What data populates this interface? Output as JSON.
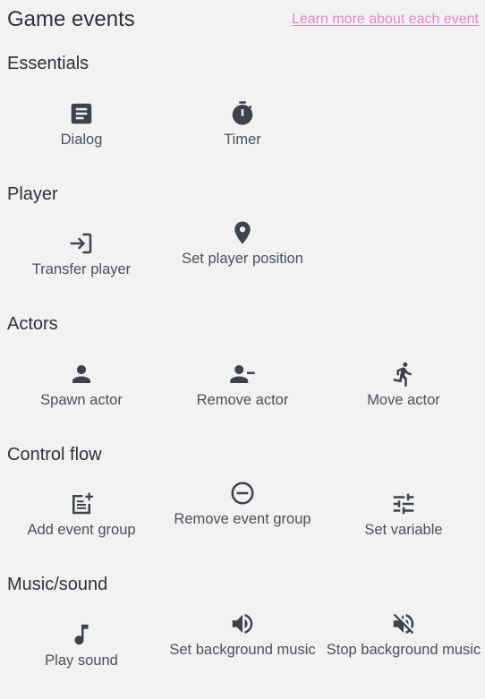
{
  "header": {
    "title": "Game events",
    "learn_link": "Learn more about each event"
  },
  "sections": [
    {
      "title": "Essentials",
      "events": [
        {
          "label": "Dialog",
          "icon": "dialog-icon"
        },
        {
          "label": "Timer",
          "icon": "timer-icon"
        }
      ]
    },
    {
      "title": "Player",
      "events": [
        {
          "label": "Transfer player",
          "icon": "transfer-icon"
        },
        {
          "label": "Set player position",
          "icon": "location-pin-icon"
        }
      ]
    },
    {
      "title": "Actors",
      "events": [
        {
          "label": "Spawn actor",
          "icon": "person-icon"
        },
        {
          "label": "Remove actor",
          "icon": "person-remove-icon"
        },
        {
          "label": "Move actor",
          "icon": "running-person-icon"
        }
      ]
    },
    {
      "title": "Control flow",
      "events": [
        {
          "label": "Add event group",
          "icon": "note-add-icon"
        },
        {
          "label": "Remove event group",
          "icon": "minus-circle-icon"
        },
        {
          "label": "Set variable",
          "icon": "sliders-icon"
        }
      ]
    },
    {
      "title": "Music/sound",
      "events": [
        {
          "label": "Play sound",
          "icon": "music-note-icon"
        },
        {
          "label": "Set background music",
          "icon": "volume-up-icon"
        },
        {
          "label": "Stop background music",
          "icon": "volume-off-icon"
        }
      ]
    }
  ],
  "colors": {
    "background": "#f2f2f2",
    "text": "#2c313a",
    "icon": "#3d434d",
    "link": "#e389c3"
  }
}
